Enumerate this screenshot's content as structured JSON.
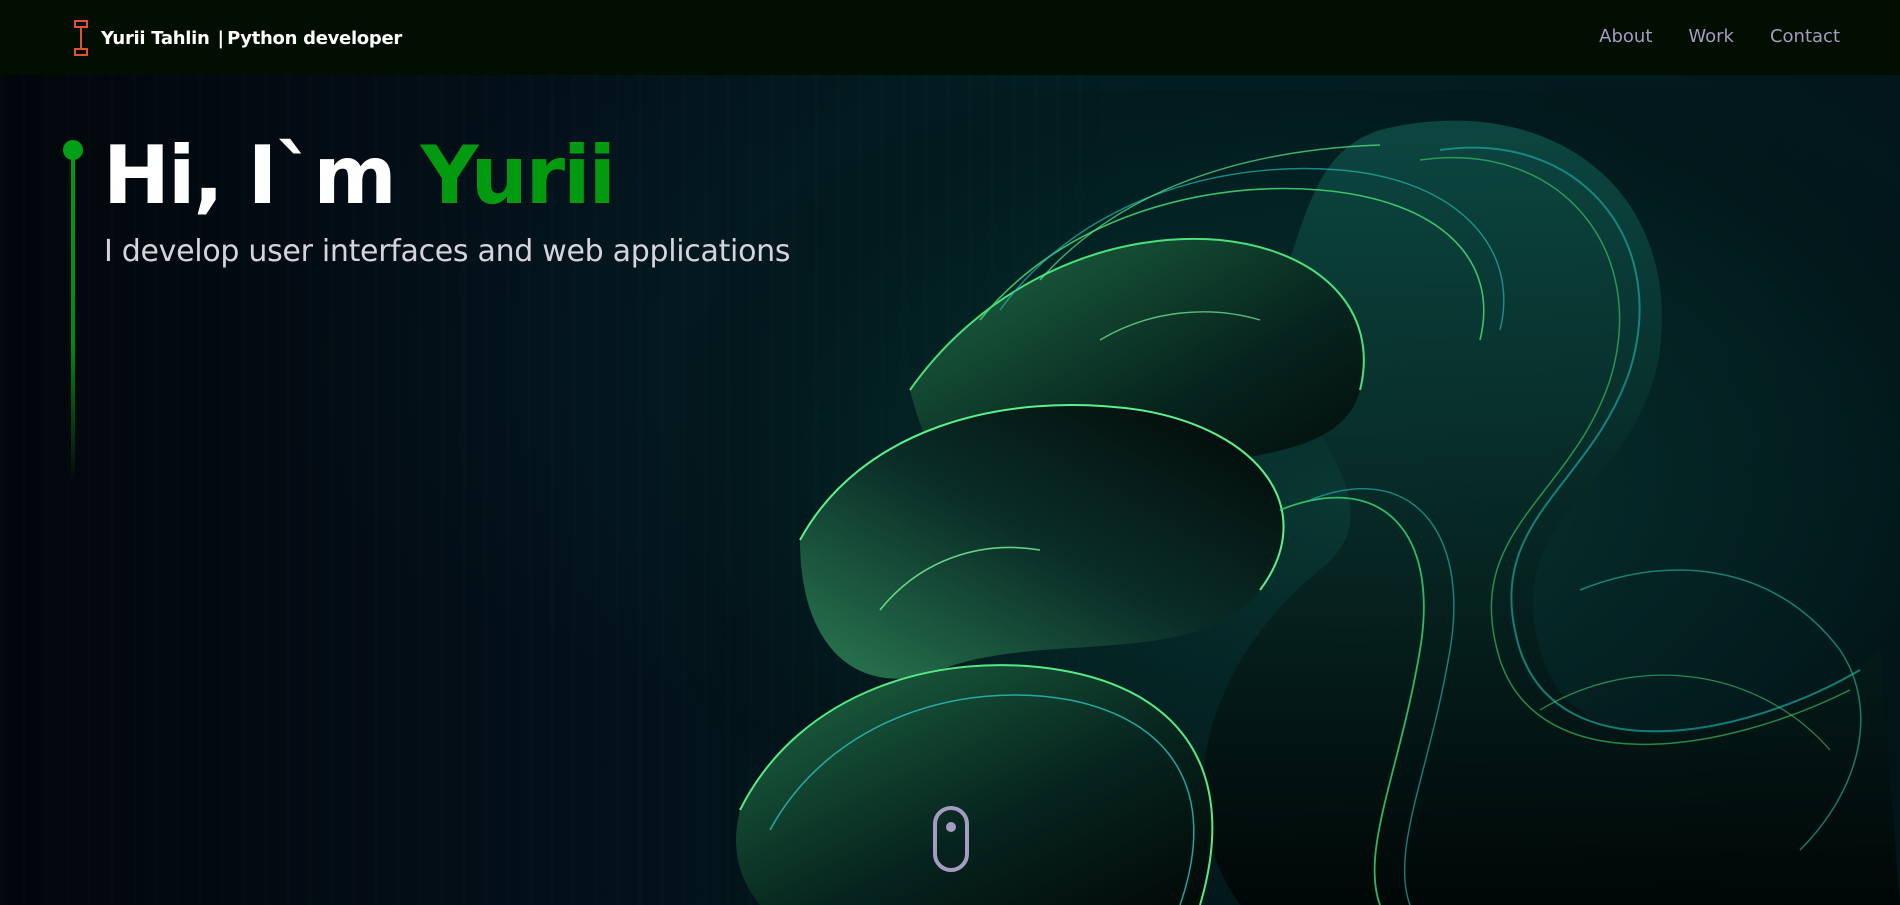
{
  "navbar": {
    "brand_name": "Yurii Tahlin",
    "brand_separator": "|",
    "brand_role": "Python developer",
    "logo_icon": "cursor-i-beam-icon",
    "links": [
      {
        "label": "About"
      },
      {
        "label": "Work"
      },
      {
        "label": "Contact"
      }
    ]
  },
  "hero": {
    "greeting": "Hi, I`m ",
    "name": "Yurii",
    "subtitle": "I develop user interfaces and web applications"
  },
  "scroll_indicator": {
    "icon": "mouse-scroll-icon"
  },
  "colors": {
    "accent": "#029b10",
    "nav_bg": "#020e02",
    "nav_link": "#a49cc0",
    "logo": "#e0542a"
  }
}
